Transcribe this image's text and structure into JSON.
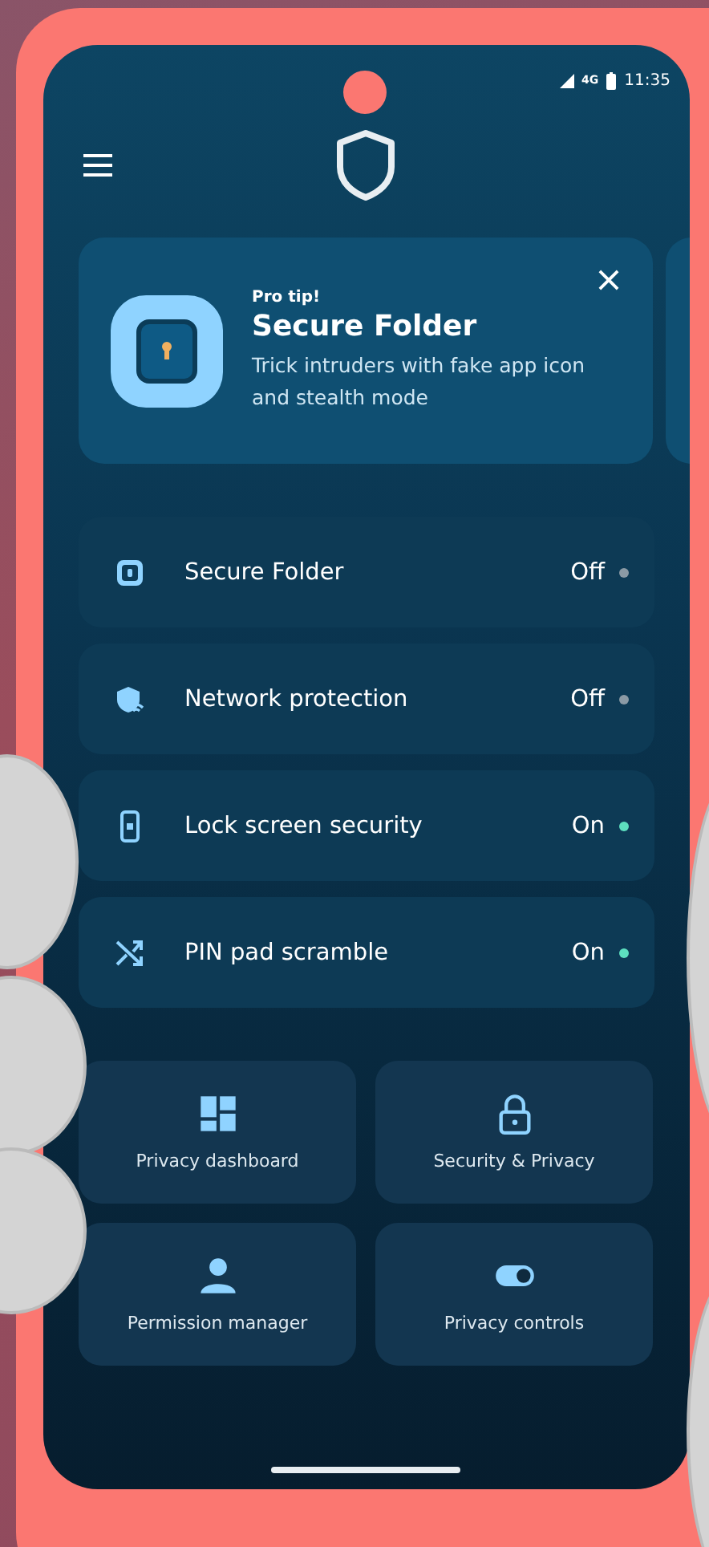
{
  "status_bar": {
    "network": "4G",
    "time": "11:35"
  },
  "tip_card": {
    "eyebrow": "Pro tip!",
    "title": "Secure Folder",
    "body": "Trick intruders with fake app icon and stealth mode"
  },
  "features": [
    {
      "label": "Secure Folder",
      "status": "Off",
      "on": false
    },
    {
      "label": "Network protection",
      "status": "Off",
      "on": false
    },
    {
      "label": "Lock screen security",
      "status": "On",
      "on": true
    },
    {
      "label": "PIN pad scramble",
      "status": "On",
      "on": true
    }
  ],
  "shortcuts": [
    {
      "label": "Privacy dashboard"
    },
    {
      "label": "Security & Privacy"
    },
    {
      "label": "Permission manager"
    },
    {
      "label": "Privacy controls"
    }
  ]
}
